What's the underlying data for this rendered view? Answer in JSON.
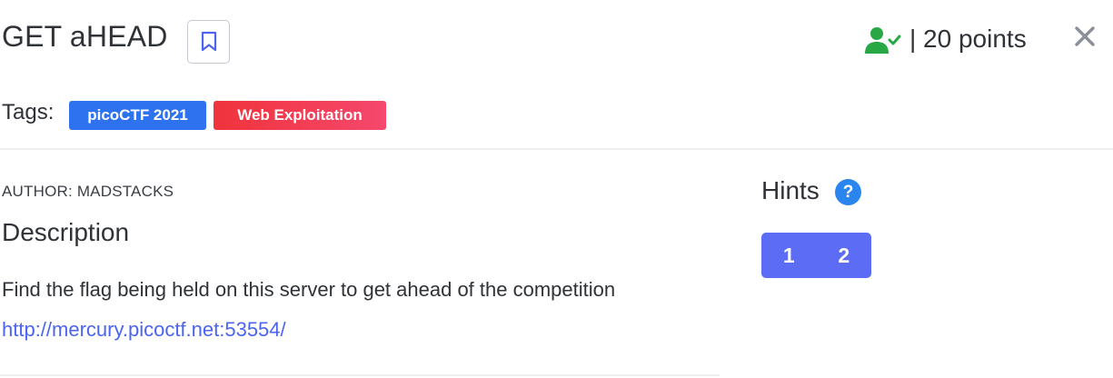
{
  "challenge": {
    "title": "GET aHEAD",
    "points_text": "| 20 points",
    "tags_label": "Tags:",
    "tags": [
      "picoCTF 2021",
      "Web Exploitation"
    ],
    "author": "AUTHOR: MADSTACKS",
    "description_heading": "Description",
    "description": "Find the flag being held on this server to get ahead of the competition",
    "link": "http://mercury.picoctf.net:53554/"
  },
  "hints": {
    "heading": "Hints",
    "help_glyph": "?",
    "buttons": [
      "1",
      "2"
    ]
  },
  "icons": {
    "bookmark": "bookmark-icon",
    "solved": "user-check-icon",
    "close": "close-icon"
  },
  "colors": {
    "accent": "#5c6cf5",
    "solved_green": "#28a745",
    "tag_blue": "#2f72f0",
    "tag_red": "#f0333c",
    "link": "#4c64f0",
    "help_blue": "#2a85ee"
  }
}
